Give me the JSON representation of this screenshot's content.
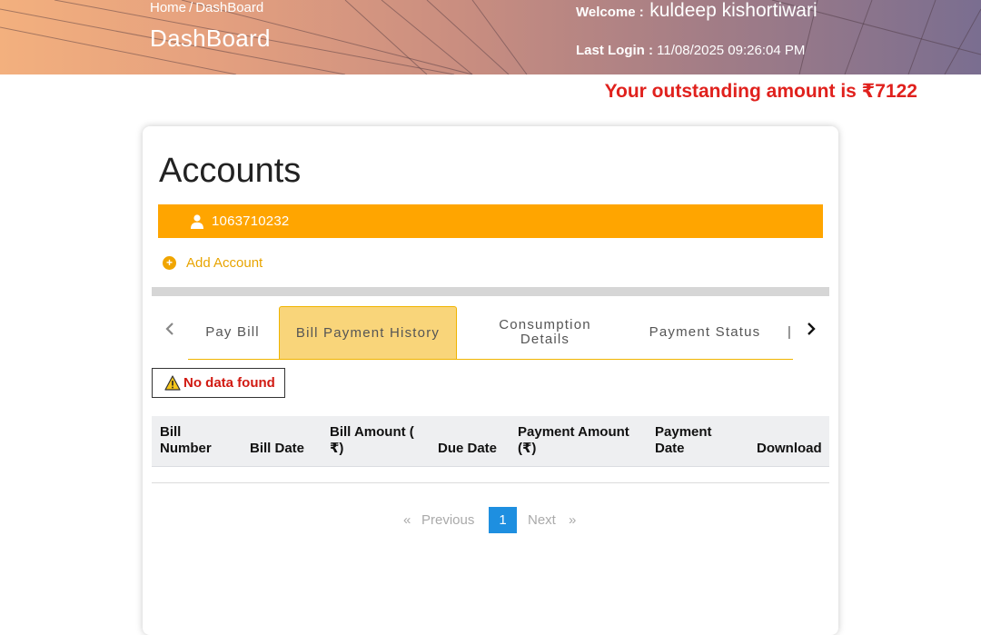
{
  "header": {
    "breadcrumb": {
      "home": "Home",
      "separator": "/",
      "current": "DashBoard"
    },
    "title": "DashBoard",
    "welcome_label": "Welcome :",
    "welcome_name": "kuldeep kishortiwari",
    "last_login_label": "Last Login :",
    "last_login_value": "11/08/2025 09:26:04 PM"
  },
  "outstanding": "Your outstanding amount is ₹7122",
  "accounts": {
    "title": "Accounts",
    "account_number": "1063710232",
    "add_account_label": "Add Account"
  },
  "tabs": [
    {
      "label": "Pay Bill",
      "active": false
    },
    {
      "label": "Bill Payment History",
      "active": true
    },
    {
      "label": "Consumption Details",
      "active": false
    },
    {
      "label": "Payment Status",
      "active": false
    }
  ],
  "message": {
    "no_data": "No data found"
  },
  "table": {
    "columns": [
      "Bill Number",
      "Bill Date",
      "Bill Amount ( ₹)",
      "Due Date",
      "Payment Amount (₹)",
      "Payment Date",
      "Download"
    ]
  },
  "pagination": {
    "first": "«",
    "previous": "Previous",
    "current": "1",
    "next": "Next",
    "last": "»"
  },
  "colors": {
    "accent_orange": "#ffa500",
    "active_tab": "#f9d57a",
    "alert_red": "#e0211d",
    "pager_blue": "#1e8fe0"
  }
}
